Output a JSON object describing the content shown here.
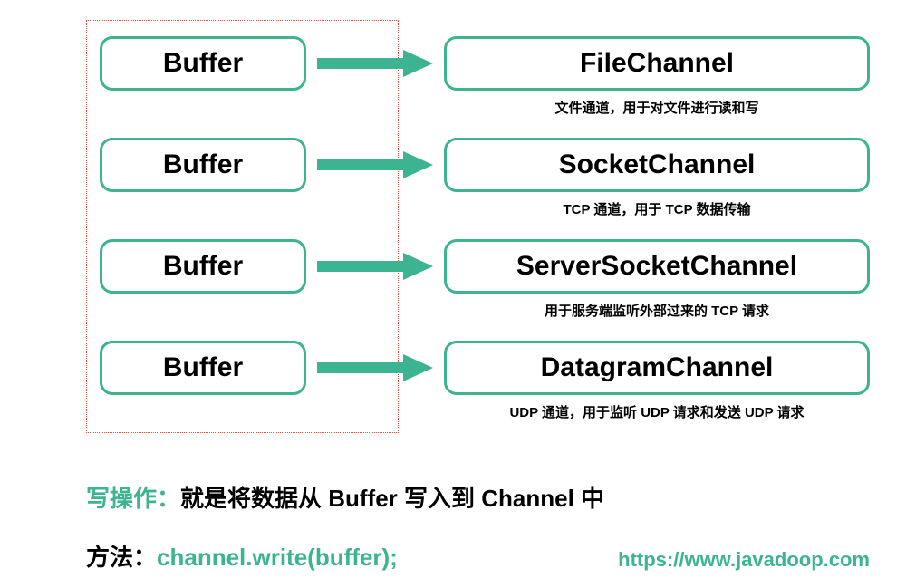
{
  "colors": {
    "accent": "#3cb492",
    "dotted_border": "#e74c3c"
  },
  "rows": [
    {
      "buffer": "Buffer",
      "channel": "FileChannel",
      "desc": "文件通道，用于对文件进行读和写"
    },
    {
      "buffer": "Buffer",
      "channel": "SocketChannel",
      "desc": "TCP 通道，用于 TCP 数据传输"
    },
    {
      "buffer": "Buffer",
      "channel": "ServerSocketChannel",
      "desc": "用于服务端监听外部过来的 TCP 请求"
    },
    {
      "buffer": "Buffer",
      "channel": "DatagramChannel",
      "desc": "UDP 通道，用于监听 UDP 请求和发送 UDP 请求"
    }
  ],
  "write_op": {
    "label": "写操作：",
    "text": "就是将数据从 Buffer 写入到 Channel 中"
  },
  "method": {
    "label": "方法：",
    "code": "channel.write(buffer);"
  },
  "url": "https://www.javadoop.com"
}
